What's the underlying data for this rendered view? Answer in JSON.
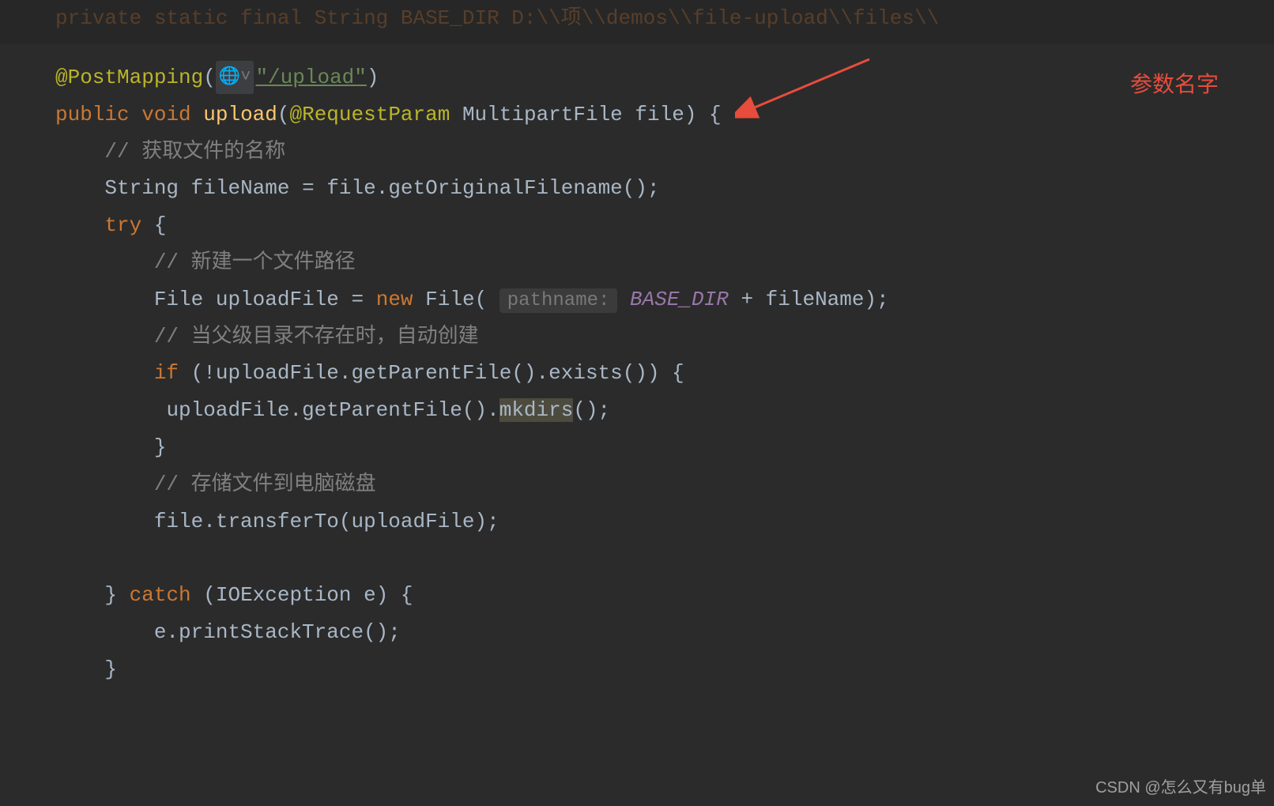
{
  "dimmed_top": "private static final String BASE_DIR    D:\\\\项\\\\demos\\\\file-upload\\\\files\\\\",
  "code": {
    "line1": {
      "annotation": "@PostMapping",
      "paren_open": "(",
      "globe": "🌐˅",
      "url_string": "\"/upload\"",
      "paren_close": ")"
    },
    "line2": {
      "public": "public",
      "void": "void",
      "method": "upload",
      "paren_open": "(",
      "req_param": "@RequestParam",
      "type": "MultipartFile",
      "param": "file",
      "paren_close_brace": ") {"
    },
    "line3_comment": "// 获取文件的名称",
    "line4": {
      "type": "String",
      "var": "fileName",
      "equals": "=",
      "rest": "file.getOriginalFilename();"
    },
    "line5": {
      "try": "try",
      "brace": "{"
    },
    "line6_comment": "// 新建一个文件路径",
    "line7": {
      "type": "File",
      "var": "uploadFile",
      "equals": "=",
      "new": "new",
      "ctor": "File",
      "paren_open": "(",
      "hint": "pathname:",
      "constant": "BASE_DIR",
      "plus": "+",
      "filename": "fileName",
      "paren_close": ");"
    },
    "line8_comment": "// 当父级目录不存在时，自动创建",
    "line9": {
      "if": "if",
      "rest": "(!uploadFile.getParentFile().exists()) {"
    },
    "line10": {
      "part1": "uploadFile.getParentFile().",
      "mkdirs": "mkdirs",
      "rest": "();"
    },
    "line11": "}",
    "line12_comment": "// 存储文件到电脑磁盘",
    "line13": "file.transferTo(uploadFile);",
    "line14": "",
    "line15": {
      "brace_close": "}",
      "catch": "catch",
      "rest": "(IOException e) {"
    },
    "line16": "e.printStackTrace();",
    "line17": "}"
  },
  "annotation_label": "参数名字",
  "watermark": "CSDN @怎么又有bug单"
}
